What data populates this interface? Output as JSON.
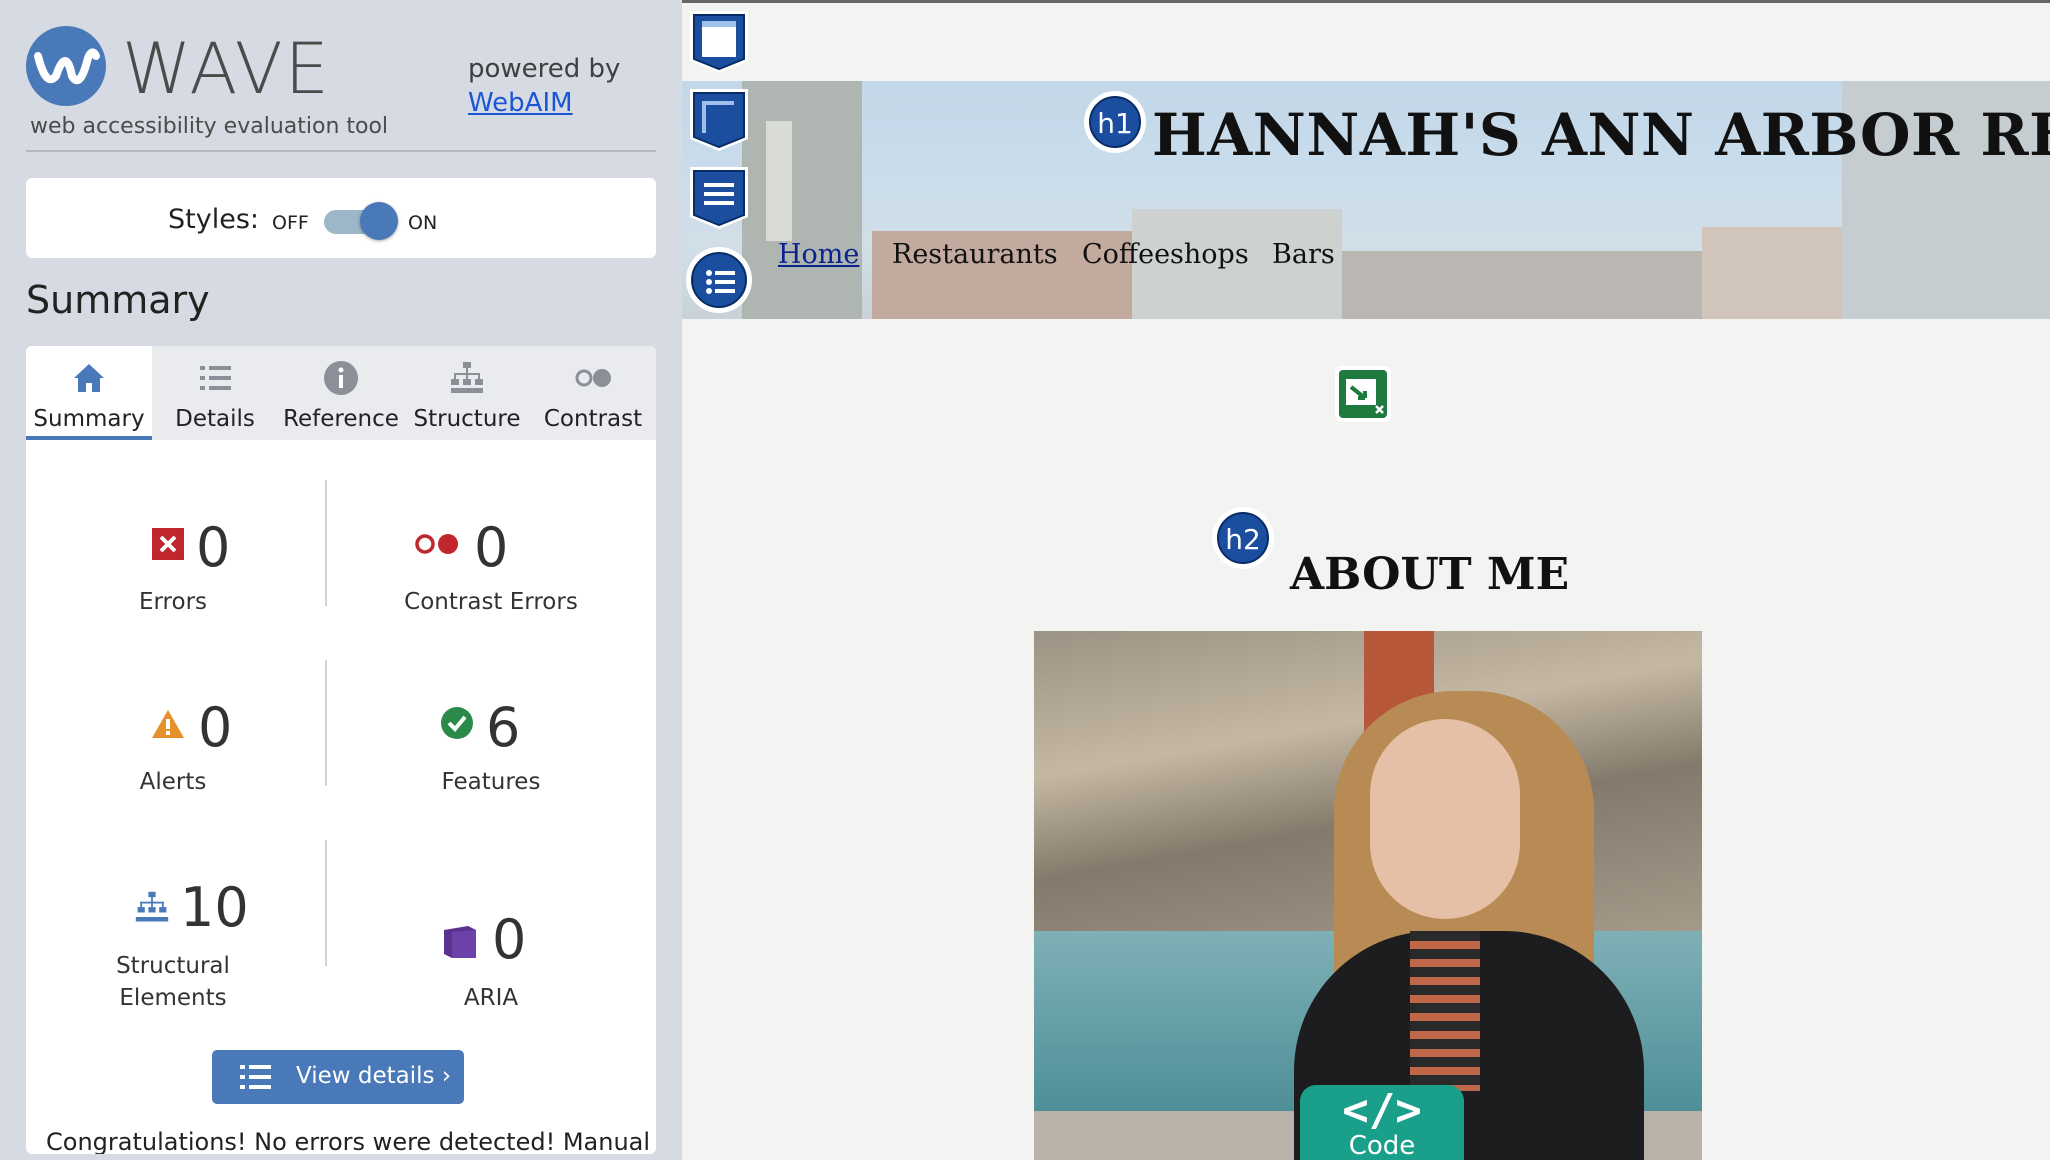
{
  "app": {
    "logo_text": "WAVE",
    "tagline": "web accessibility evaluation tool",
    "powered_by": "powered by",
    "powered_link": "WebAIM"
  },
  "styles_toggle": {
    "label": "Styles:",
    "off": "OFF",
    "on": "ON",
    "state": "on"
  },
  "summary_title": "Summary",
  "tabs": [
    {
      "label": "Summary",
      "icon": "home-icon",
      "active": true
    },
    {
      "label": "Details",
      "icon": "list-icon",
      "active": false
    },
    {
      "label": "Reference",
      "icon": "info-icon",
      "active": false
    },
    {
      "label": "Structure",
      "icon": "structure-icon",
      "active": false
    },
    {
      "label": "Contrast",
      "icon": "contrast-icon",
      "active": false
    }
  ],
  "stats": {
    "errors": {
      "value": "0",
      "label": "Errors",
      "color": "#c0272d"
    },
    "contrast_errors": {
      "value": "0",
      "label": "Contrast Errors",
      "color": "#c0272d"
    },
    "alerts": {
      "value": "0",
      "label": "Alerts",
      "color": "#e5902a"
    },
    "features": {
      "value": "6",
      "label": "Features",
      "color": "#2b8a4a"
    },
    "structural": {
      "value": "10",
      "label_line1": "Structural",
      "label_line2": "Elements",
      "color": "#4a79b9"
    },
    "aria": {
      "value": "0",
      "label": "ARIA",
      "color": "#5a3290"
    }
  },
  "view_details": "View details ›",
  "congrats": "Congratulations! No errors were detected! Manual",
  "page": {
    "title": "HANNAH'S ANN ARBOR REVIEW",
    "nav": [
      "Home",
      "Restaurants",
      "Coffeeshops",
      "Bars"
    ],
    "h1_badge": "h1",
    "h2_badge": "h2",
    "about": "ABOUT ME",
    "code_tab_glyph": "</>",
    "code_tab_label": "Code"
  },
  "colors": {
    "accent": "#4a79b9",
    "sidebar_bg": "#d6dae2",
    "heading_badge": "#1b4e9e",
    "code_tab": "#1a9f8b"
  }
}
